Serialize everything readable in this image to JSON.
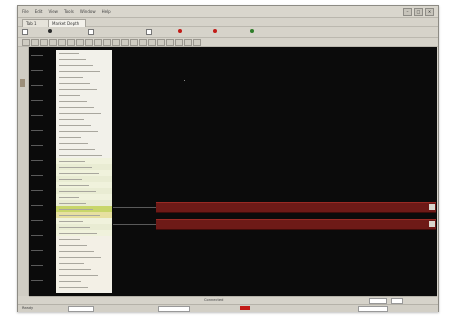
{
  "menu": [
    "File",
    "Edit",
    "View",
    "Tools",
    "Window",
    "Help"
  ],
  "tabs": [
    "Tab 1",
    "Market Depth"
  ],
  "ladder": {
    "rows": 40
  },
  "status": {
    "center": "Connected",
    "left": "Ready"
  },
  "colors": {
    "plot_bg": "#0b0b0b",
    "bar": "#6e1a17",
    "ladder_bg": "#f2f1ea",
    "alert": "#c21b17"
  }
}
